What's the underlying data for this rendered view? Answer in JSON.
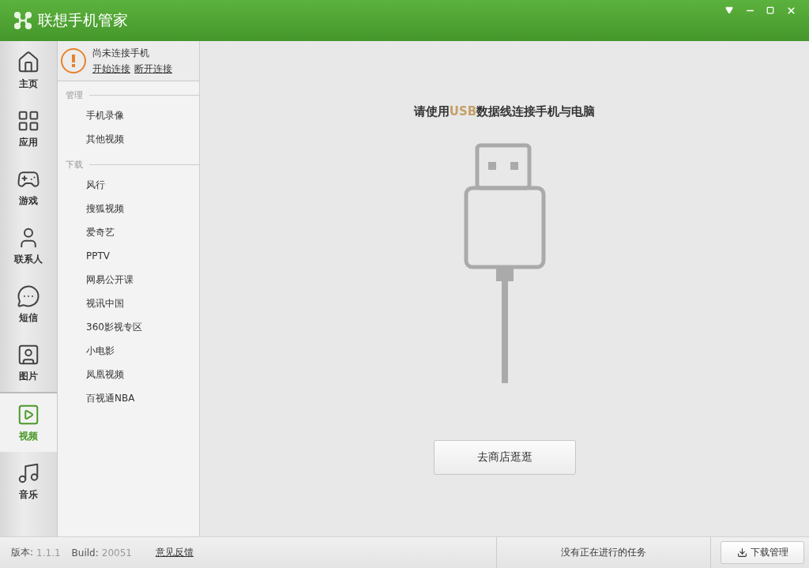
{
  "window": {
    "title": "联想手机管家"
  },
  "nav": [
    {
      "label": "主页",
      "kind": "home",
      "selected": false
    },
    {
      "label": "应用",
      "kind": "apps",
      "selected": false
    },
    {
      "label": "游戏",
      "kind": "game",
      "selected": false
    },
    {
      "label": "联系人",
      "kind": "contact",
      "selected": false
    },
    {
      "label": "短信",
      "kind": "sms",
      "selected": false
    },
    {
      "label": "图片",
      "kind": "picture",
      "selected": false
    },
    {
      "label": "视频",
      "kind": "video",
      "selected": true
    },
    {
      "label": "音乐",
      "kind": "music",
      "selected": false
    }
  ],
  "device": {
    "status": "尚未连接手机",
    "links": [
      "开始连接",
      "断开连接"
    ]
  },
  "sections": [
    {
      "title": "管理",
      "items": [
        "手机录像",
        "其他视频"
      ]
    },
    {
      "title": "下载",
      "items": [
        "风行",
        "搜狐视频",
        "爱奇艺",
        "PPTV",
        "网易公开课",
        "视讯中国",
        "360影视专区",
        "小电影",
        "凤凰视频",
        "百视通NBA"
      ]
    }
  ],
  "main": {
    "heading": "请使用**USB**数据线连接手机与电脑",
    "button": "去商店逛逛"
  },
  "status_bar": {
    "version_label": "版本:",
    "version": "1.1.1",
    "build_label": "Build:",
    "build": "20051",
    "feedback": "意见反馈",
    "tasks": "没有正在进行的任务",
    "download_button": "下载管理"
  }
}
